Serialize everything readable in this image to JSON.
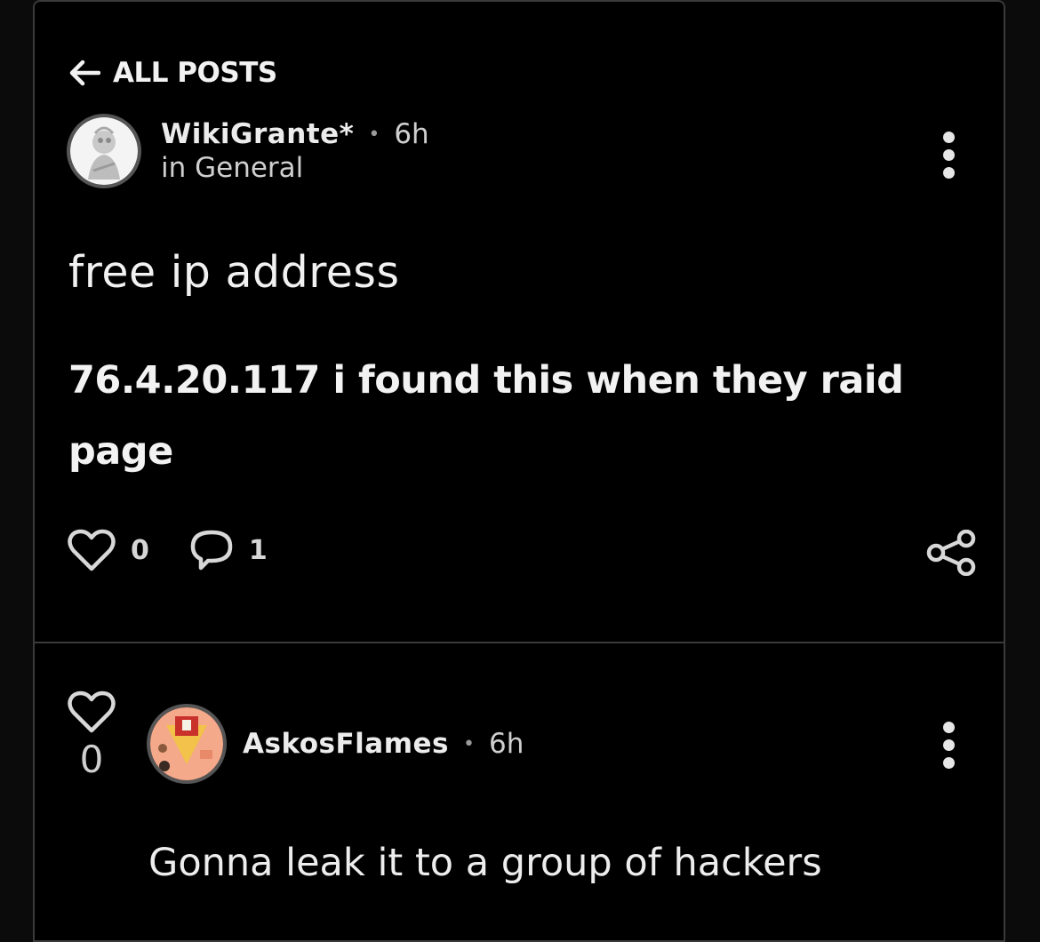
{
  "nav": {
    "back_label": "ALL POSTS"
  },
  "post": {
    "author": "WikiGrante*",
    "separator": "•",
    "time": "6h",
    "category_text": "in General",
    "title": "free ip address",
    "body": "76.4.20.117 i found this when they raid page",
    "likes": "0",
    "comments": "1"
  },
  "comment": {
    "likes": "0",
    "author": "AskosFlames",
    "separator": "•",
    "time": "6h",
    "text": "Gonna leak it to a group of hackers"
  },
  "icons": {
    "back": "arrow-left-icon",
    "more": "more-vertical-icon",
    "like": "heart-icon",
    "comment": "comment-bubble-icon",
    "share": "share-icon"
  },
  "colors": {
    "background": "#000000",
    "border": "#3a3a3a",
    "text": "#f2f2f2",
    "muted": "#cfcfcf"
  }
}
